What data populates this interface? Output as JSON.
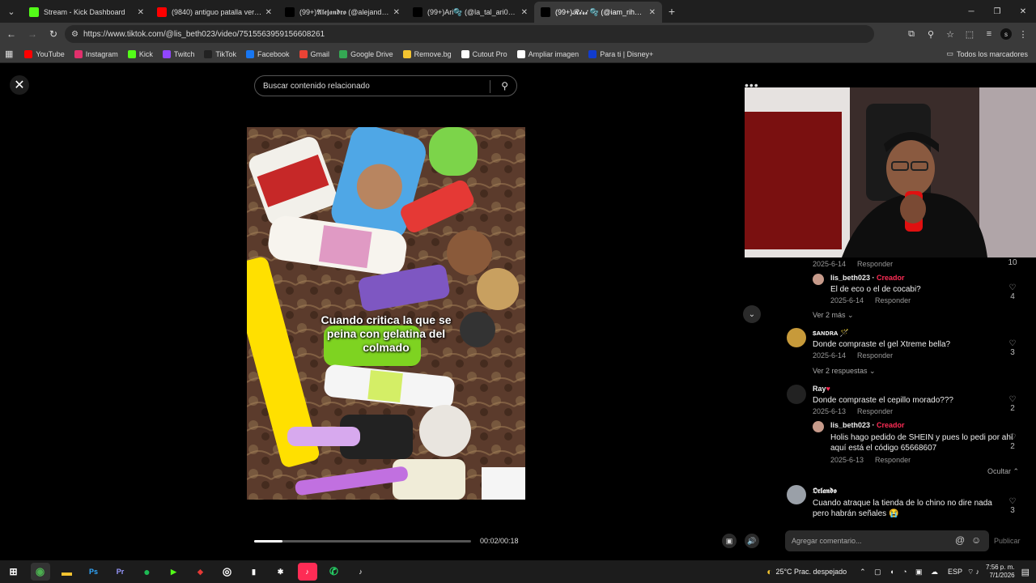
{
  "browser": {
    "tabs": [
      {
        "title": "Stream - Kick Dashboard",
        "icon": "kick-icon",
        "color": "#53fc18",
        "active": false
      },
      {
        "title": "(9840) antiguo patalla verde - Y",
        "icon": "youtube-icon",
        "color": "#ff0000",
        "active": false
      },
      {
        "title": "(99+)𝕬𝖑𝖊𝖏𝖆𝖓𝖉𝖗𝖔 (@alejandr10v)",
        "icon": "tiktok-icon",
        "color": "#000000",
        "active": false
      },
      {
        "title": "(99+)Ari🫧 (@la_tal_ari0) | TikTok",
        "icon": "tiktok-icon",
        "color": "#000000",
        "active": false
      },
      {
        "title": "(99+)𝓡𝓲𝓻𝓲 🫧 (@iam_rihann",
        "icon": "tiktok-icon",
        "color": "#000000",
        "active": true
      }
    ],
    "url": "https://www.tiktok.com/@lis_beth023/video/7515563959156608261",
    "bookmarks": [
      {
        "label": "YouTube",
        "icon": "youtube-icon",
        "color": "#ff0000"
      },
      {
        "label": "Instagram",
        "icon": "instagram-icon",
        "color": "#e1306c"
      },
      {
        "label": "Kick",
        "icon": "kick-icon",
        "color": "#53fc18"
      },
      {
        "label": "Twitch",
        "icon": "twitch-icon",
        "color": "#9146ff"
      },
      {
        "label": "TikTok",
        "icon": "tiktok-icon",
        "color": "#222222"
      },
      {
        "label": "Facebook",
        "icon": "facebook-icon",
        "color": "#1877f2"
      },
      {
        "label": "Gmail",
        "icon": "gmail-icon",
        "color": "#ea4335"
      },
      {
        "label": "Google Drive",
        "icon": "drive-icon",
        "color": "#34a853"
      },
      {
        "label": "Remove.bg",
        "icon": "removebg-icon",
        "color": "#f4c430"
      },
      {
        "label": "Cutout Pro",
        "icon": "cutout-icon",
        "color": "#ffffff"
      },
      {
        "label": "Ampliar imagen",
        "icon": "ampliar-icon",
        "color": "#ffffff"
      },
      {
        "label": "Para ti | Disney+",
        "icon": "disney-icon",
        "color": "#113ccf"
      }
    ],
    "all_bookmarks": "Todos los marcadores"
  },
  "player": {
    "search_placeholder": "Buscar contenido relacionado",
    "caption": "Cuando critica la que se peina con gelatina del colmado",
    "time": "00:02/00:18",
    "progress": 0.13
  },
  "comments": [
    {
      "date": "2025-6-14",
      "reply": "Responder",
      "likes": "10"
    },
    {
      "user": "lis_beth023",
      "badge": "Creador",
      "text": "El de eco o el de cocabi?",
      "date": "2025-6-14",
      "reply": "Responder",
      "likes": "4"
    },
    {
      "more": "Ver 2 más"
    },
    {
      "user": "ꜱᴀɴᴅʀᴀ 🪄",
      "text": "Donde compraste el gel Xtreme bella?",
      "date": "2025-6-14",
      "reply": "Responder",
      "likes": "3"
    },
    {
      "more": "Ver 2 respuestas"
    },
    {
      "user": "Ray",
      "text": "Donde compraste el cepillo morado???",
      "date": "2025-6-13",
      "reply": "Responder",
      "likes": "2"
    },
    {
      "user": "lis_beth023",
      "badge": "Creador",
      "text": "Holis hago pedido de SHEIN y pues lo pedi por ahí aquí está el código 65668607",
      "date": "2025-6-13",
      "reply": "Responder",
      "likes": "2"
    },
    {
      "more": "Ocultar"
    },
    {
      "user": "𝕺𝖗𝖑𝖆𝖓𝖉𝖔",
      "text": "Cuando atraque la tienda de lo chino no dire nada pero habrán señales 😭",
      "likes": "3"
    }
  ],
  "composer": {
    "placeholder": "Agregar comentario...",
    "publish": "Publicar"
  },
  "taskbar": {
    "weather": "25°C  Prac. despejado",
    "lang": "ESP",
    "time": "7:56 p. m.",
    "date": "7/1/2026"
  }
}
